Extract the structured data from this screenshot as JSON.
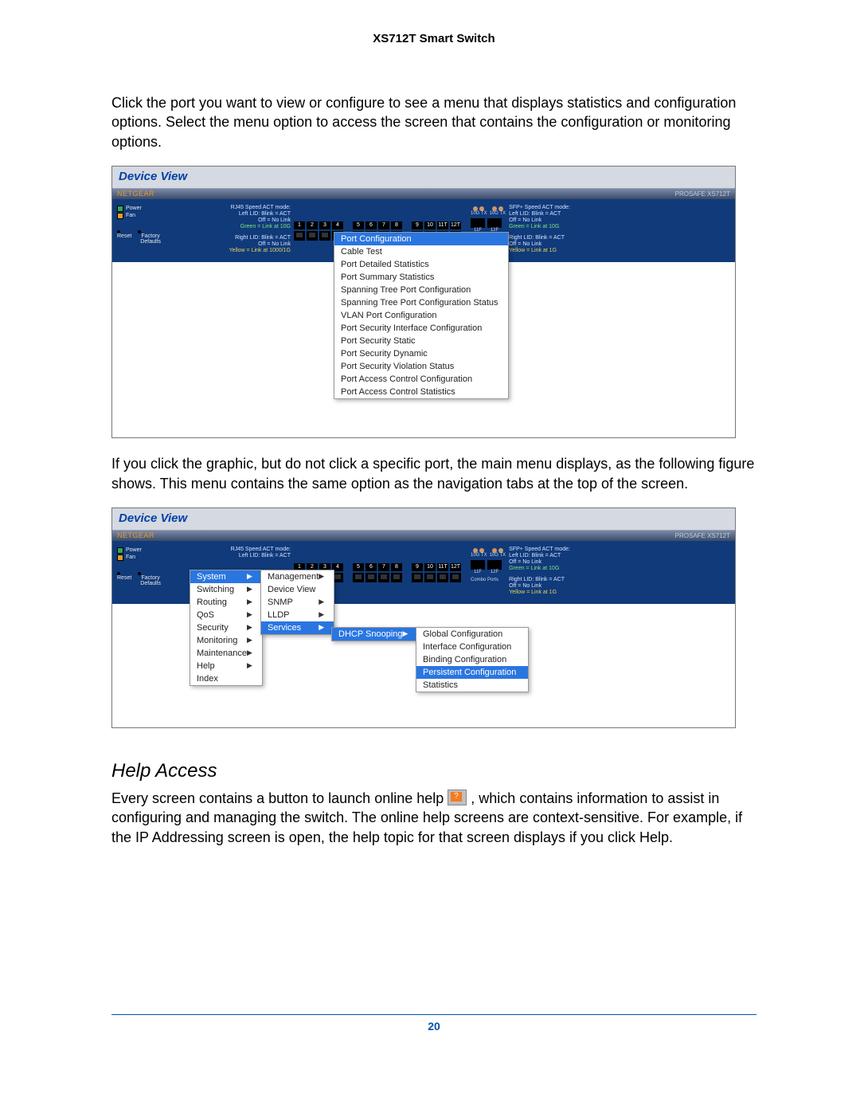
{
  "doc_title": "XS712T Smart Switch",
  "para1": "Click the port you want to view or configure to see a menu that displays statistics and configuration options. Select the menu option to access the screen that contains the configuration or monitoring options.",
  "para2": "If you click the graphic, but do not click a specific port, the main menu displays, as the following figure shows. This menu contains the same option as the navigation tabs at the top of the screen.",
  "help_heading": "Help Access",
  "para3a": "Every screen contains a button to launch online help ",
  "para3b": " , which contains information to assist in configuring and managing the switch. The online help screens are context-sensitive. For example, if the IP Addressing screen is open, the help topic for that screen displays if you click Help.",
  "page_number": "20",
  "panel": {
    "title": "Device View",
    "brand": "NETGEAR",
    "model": "PROSAFE XS712T",
    "leds": {
      "power": "Power",
      "fan": "Fan",
      "reset": "Reset",
      "factory": "Factory\nDefaults"
    },
    "legend_left": {
      "l1": "RJ45 Speed ACT mode:",
      "l2": "Left LID: Blink = ACT",
      "l3": "Off = No Link",
      "l4": "Green = Link at 10G",
      "l5": "Right LID: Blink = ACT",
      "l6": "Off = No Link",
      "l7": "Yellow = Link at 1000/1G"
    },
    "legend_right": {
      "r1": "SFP+ Speed ACT mode:",
      "r2": "Left LID: Blink = ACT",
      "r3": "Off = No Link",
      "r4": "Green = Link at 10G",
      "r5": "Right LID: Blink = ACT",
      "r6": "Off = No Link",
      "r7": "Yellow = Link at 1G"
    },
    "sfp": {
      "a": "11F",
      "b": "12F",
      "tx1": "10G TX",
      "tx2": "10G TX"
    },
    "combo": "Combo Ports",
    "ports": [
      "1",
      "2",
      "3",
      "4",
      "5",
      "6",
      "7",
      "8",
      "9",
      "10",
      "11T",
      "12T"
    ]
  },
  "fig1_menu": {
    "items": [
      "Port Configuration",
      "Cable Test",
      "Port Detailed Statistics",
      "Port Summary Statistics",
      "Spanning Tree Port Configuration",
      "Spanning Tree Port Configuration Status",
      "VLAN Port Configuration",
      "Port Security Interface Configuration",
      "Port Security Static",
      "Port Security Dynamic",
      "Port Security Violation Status",
      "Port Access Control Configuration",
      "Port Access Control Statistics"
    ],
    "selected": "Port Configuration"
  },
  "fig2_menu": {
    "col1": [
      {
        "label": "System",
        "sel": true,
        "arrow": true
      },
      {
        "label": "Switching",
        "arrow": true
      },
      {
        "label": "Routing",
        "arrow": true
      },
      {
        "label": "QoS",
        "arrow": true
      },
      {
        "label": "Security",
        "arrow": true
      },
      {
        "label": "Monitoring",
        "arrow": true
      },
      {
        "label": "Maintenance",
        "arrow": true
      },
      {
        "label": "Help",
        "arrow": true
      },
      {
        "label": "Index"
      }
    ],
    "col2": [
      {
        "label": "Management",
        "arrow": true
      },
      {
        "label": "Device View"
      },
      {
        "label": "SNMP",
        "arrow": true
      },
      {
        "label": "LLDP",
        "arrow": true
      },
      {
        "label": "Services",
        "sel": true,
        "arrow": true
      }
    ],
    "col3": [
      {
        "label": "DHCP Snooping",
        "sel": true,
        "arrow": true
      }
    ],
    "col4": [
      {
        "label": "Global Configuration"
      },
      {
        "label": "Interface Configuration"
      },
      {
        "label": "Binding Configuration"
      },
      {
        "label": "Persistent Configuration",
        "sel": true
      },
      {
        "label": "Statistics"
      }
    ]
  }
}
